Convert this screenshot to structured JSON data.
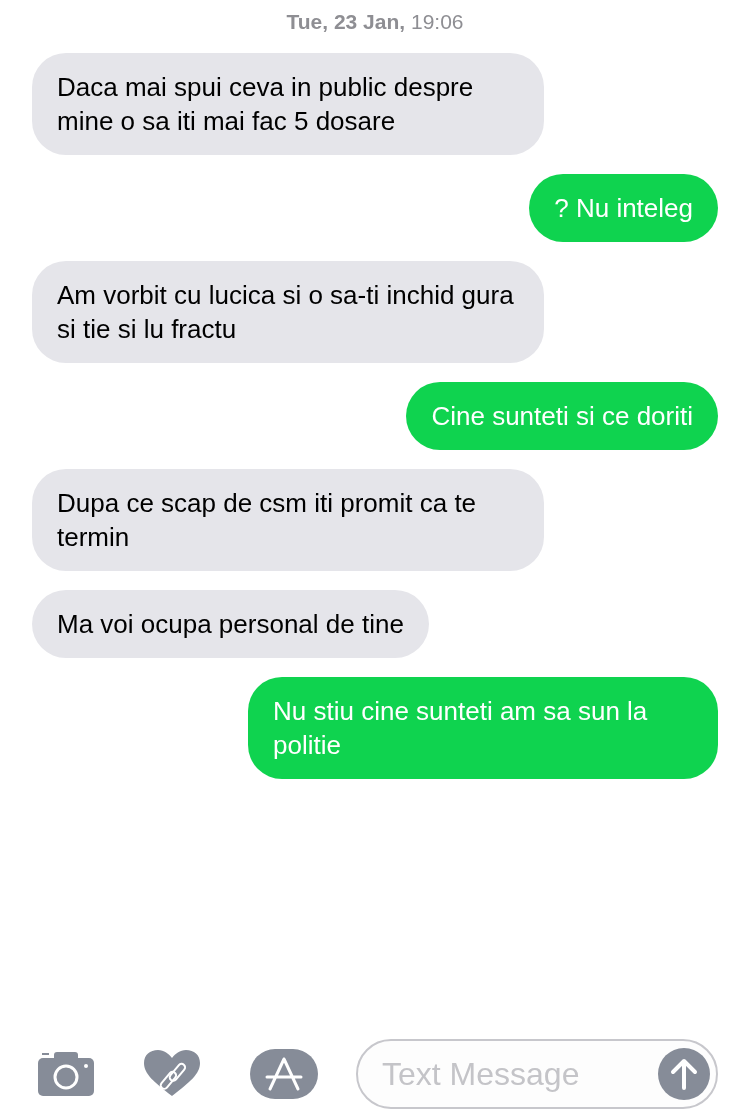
{
  "timestamp": "**Tue, 23 Jan,** 19:06",
  "messages": [
    {
      "kind": "incoming",
      "text": "Daca mai spui ceva in public despre mine o sa iti mai fac 5 dosare"
    },
    {
      "kind": "outgoing",
      "text": "? Nu inteleg"
    },
    {
      "kind": "incoming",
      "text": "Am vorbit cu lucica si o sa-ti inchid gura si tie si lu fractu"
    },
    {
      "kind": "outgoing",
      "text": "Cine sunteti si ce doriti"
    },
    {
      "kind": "incoming",
      "text": "Dupa ce scap de csm iti promit ca te termin"
    },
    {
      "kind": "incoming",
      "text": "Ma voi ocupa personal de tine"
    },
    {
      "kind": "outgoing",
      "text": "Nu stiu cine sunteti am sa sun la politie"
    }
  ],
  "composer": {
    "placeholder": "Text Message"
  }
}
